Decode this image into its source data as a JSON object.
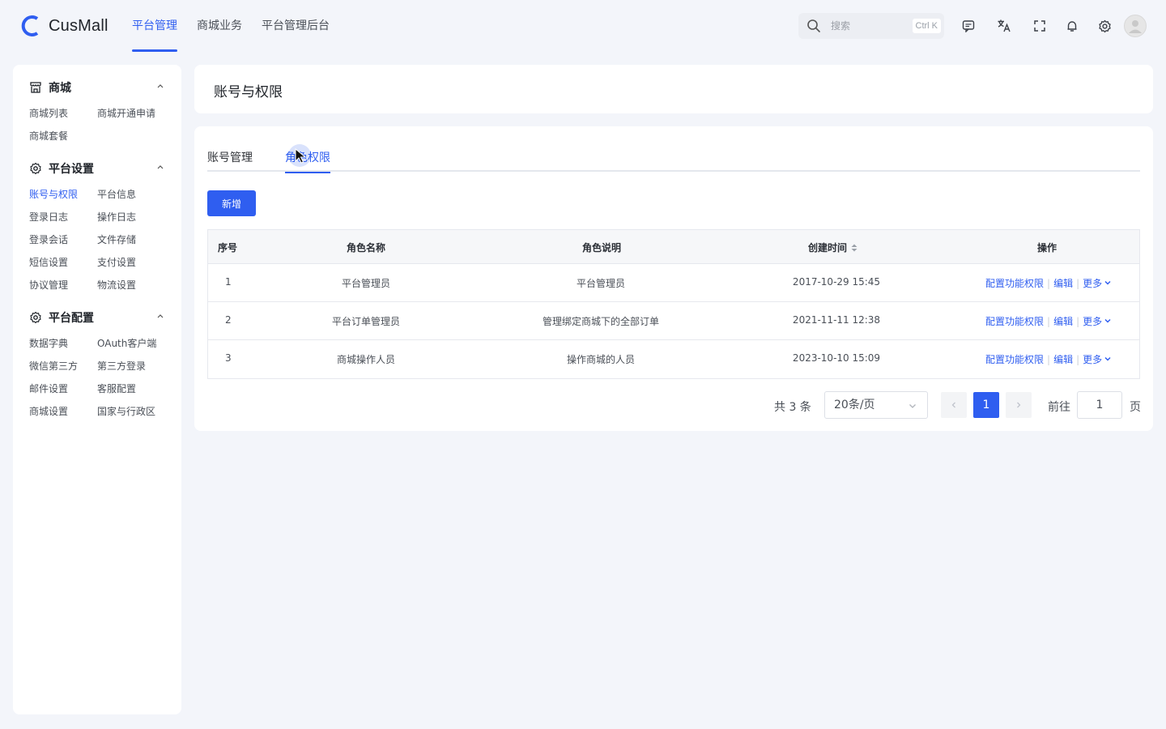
{
  "app": {
    "name": "CusMall"
  },
  "top_nav": [
    {
      "label": "平台管理",
      "active": true
    },
    {
      "label": "商城业务",
      "active": false
    },
    {
      "label": "平台管理后台",
      "active": false
    }
  ],
  "search": {
    "placeholder": "搜索",
    "shortcut": "Ctrl K"
  },
  "header_icons": [
    "message-icon",
    "translate-icon",
    "fullscreen-icon",
    "bell-icon",
    "settings-icon"
  ],
  "sidebar": {
    "groups": [
      {
        "title": "商城",
        "icon": "store-icon",
        "items": [
          "商城列表",
          "商城开通申请",
          "商城套餐"
        ]
      },
      {
        "title": "平台设置",
        "icon": "gear-icon",
        "items": [
          "账号与权限",
          "平台信息",
          "登录日志",
          "操作日志",
          "登录会话",
          "文件存储",
          "短信设置",
          "支付设置",
          "协议管理",
          "物流设置"
        ]
      },
      {
        "title": "平台配置",
        "icon": "gear-icon",
        "items": [
          "数据字典",
          "OAuth客户端",
          "微信第三方",
          "第三方登录",
          "邮件设置",
          "客服配置",
          "商城设置",
          "国家与行政区"
        ]
      }
    ],
    "active_item": "账号与权限"
  },
  "page": {
    "title": "账号与权限"
  },
  "tabs": [
    {
      "label": "账号管理",
      "active": false
    },
    {
      "label": "角色权限",
      "active": true
    }
  ],
  "toolbar": {
    "add_label": "新增"
  },
  "table": {
    "columns": [
      "序号",
      "角色名称",
      "角色说明",
      "创建时间",
      "操作"
    ],
    "rows": [
      {
        "index": "1",
        "name": "平台管理员",
        "desc": "平台管理员",
        "created": "2017-10-29 15:45"
      },
      {
        "index": "2",
        "name": "平台订单管理员",
        "desc": "管理绑定商城下的全部订单",
        "created": "2021-11-11 12:38"
      },
      {
        "index": "3",
        "name": "商城操作人员",
        "desc": "操作商城的人员",
        "created": "2023-10-10 15:09"
      }
    ],
    "actions": {
      "config": "配置功能权限",
      "edit": "编辑",
      "more": "更多"
    }
  },
  "pagination": {
    "total_text": "共 3 条",
    "page_size": "20条/页",
    "current_page": "1",
    "goto_label": "前往",
    "goto_value": "1",
    "goto_suffix": "页"
  },
  "colors": {
    "accent": "#2f5ef0",
    "background": "#f3f5fa"
  }
}
